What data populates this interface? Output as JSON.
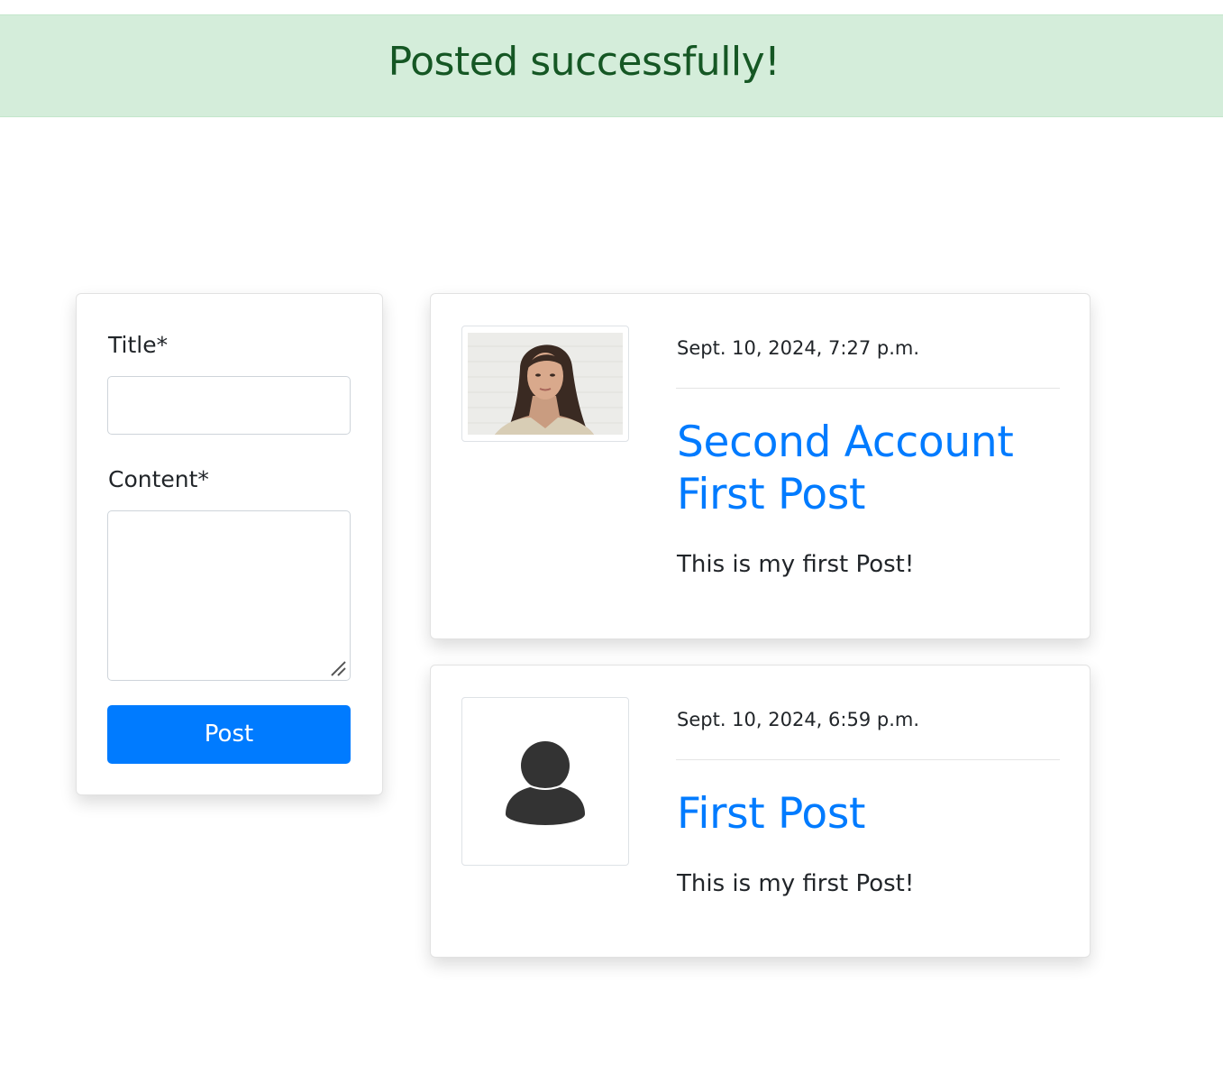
{
  "alert": {
    "message": "Posted successfully!",
    "background": "#d4edda",
    "text_color": "#155724"
  },
  "form": {
    "title_label": "Title*",
    "title_value": "",
    "content_label": "Content*",
    "content_value": "",
    "submit_label": "Post",
    "submit_color": "#007bff"
  },
  "posts": [
    {
      "date": "Sept. 10, 2024, 7:27 p.m.",
      "title": "Second Account First Post",
      "content": "This is my first Post!",
      "avatar": "profile-photo"
    },
    {
      "date": "Sept. 10, 2024, 6:59 p.m.",
      "title": "First Post",
      "content": "This is my first Post!",
      "avatar": "default-user-icon"
    }
  ],
  "colors": {
    "accent": "#007bff",
    "text": "#212529"
  }
}
